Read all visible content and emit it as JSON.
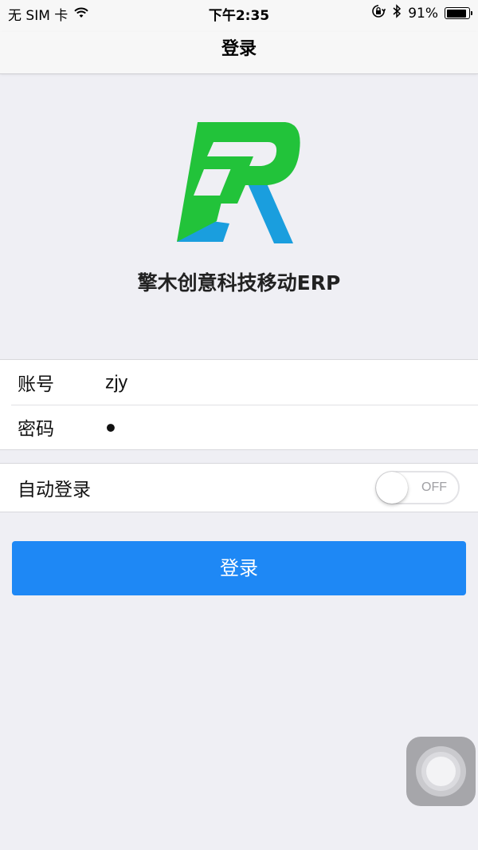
{
  "status_bar": {
    "carrier": "无 SIM 卡",
    "wifi_icon": "wifi-icon",
    "time": "下午2:35",
    "lock_icon": "rotation-lock-icon",
    "bluetooth_icon": "bluetooth-icon",
    "battery_percent": "91%",
    "battery_level": 0.91
  },
  "nav": {
    "title": "登录"
  },
  "logo": {
    "icon": "erp-logo",
    "green": "#22c33a",
    "blue": "#1a9ede"
  },
  "app_name": "擎木创意科技移动ERP",
  "form": {
    "account_label": "账号",
    "account_value": "zjy",
    "password_label": "密码",
    "password_value": "●"
  },
  "auto_login": {
    "label": "自动登录",
    "toggle_state": "OFF"
  },
  "login_button": {
    "label": "登录",
    "color": "#1e88f5"
  }
}
